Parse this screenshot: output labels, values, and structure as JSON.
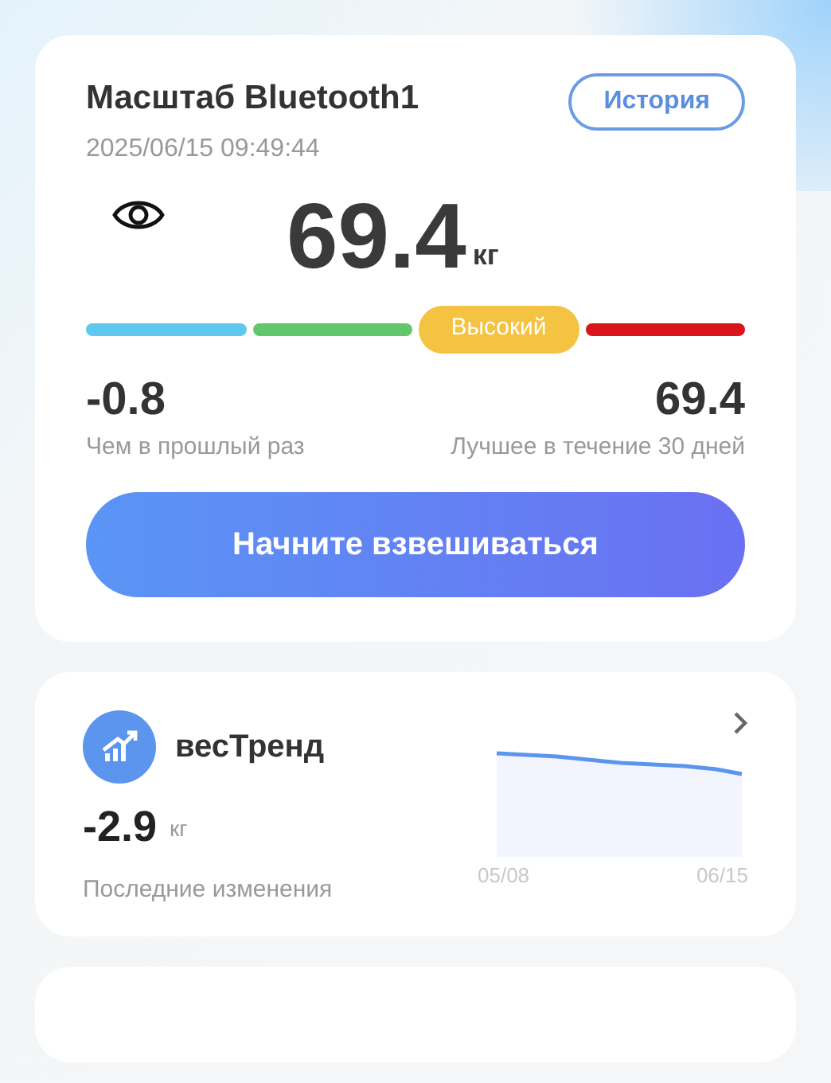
{
  "scale_card": {
    "title": "Масштаб Bluetooth1",
    "timestamp": "2025/06/15 09:49:44",
    "history_button": "История",
    "weight": "69.4",
    "unit": "кг",
    "segments": [
      {
        "color": "#5ec8ef",
        "selected": false
      },
      {
        "color": "#62c76b",
        "selected": false
      },
      {
        "color": "#f5c342",
        "selected": true,
        "label": "Высокий"
      },
      {
        "color": "#d9141b",
        "selected": false
      }
    ],
    "stats": [
      {
        "value": "-0.8",
        "label": "Чем в прошлый раз"
      },
      {
        "value": "69.4",
        "label": "Лучшее в течение 30 дней"
      }
    ],
    "start_button": "Начните взвешиваться"
  },
  "trend_card": {
    "title": "весТренд",
    "change": "-2.9",
    "unit": "кг",
    "caption": "Последние изменения",
    "x_labels": [
      "05/08",
      "06/15"
    ]
  }
}
